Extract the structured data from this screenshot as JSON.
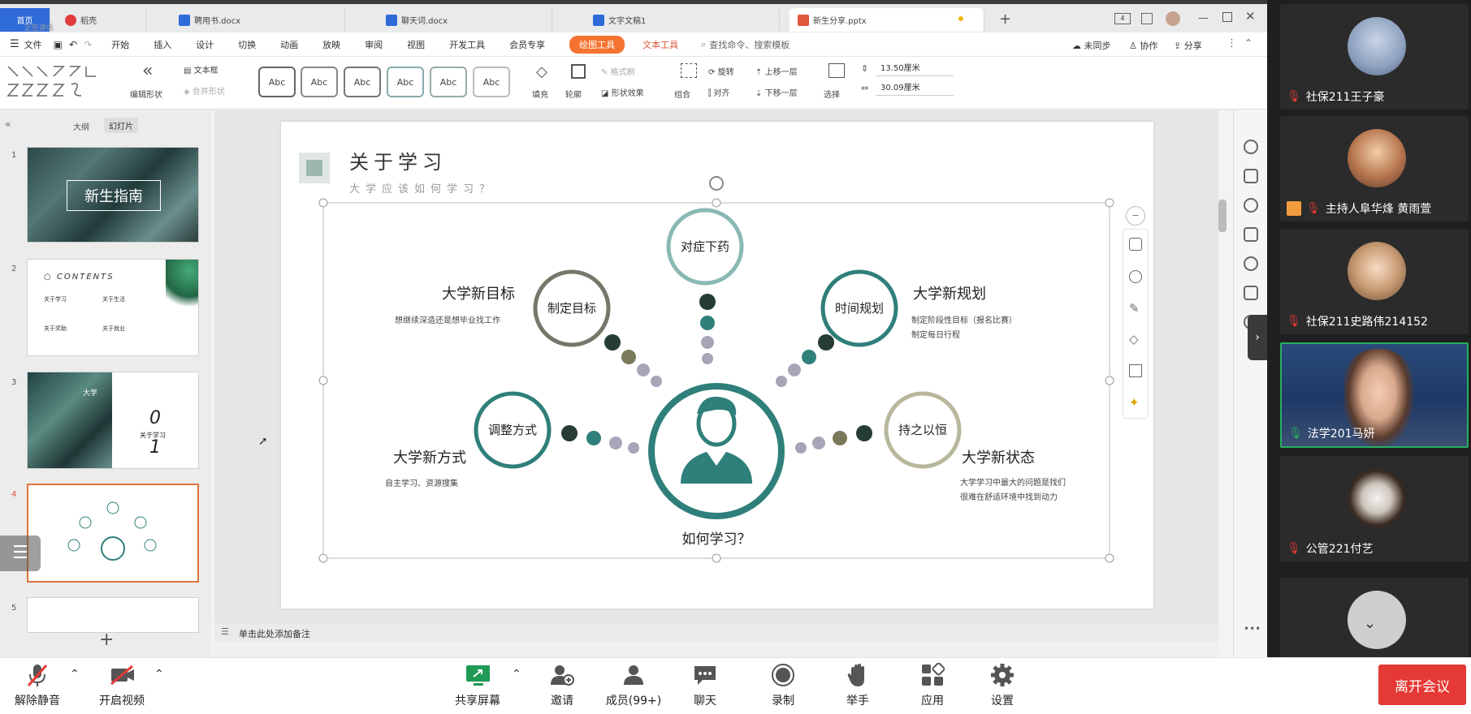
{
  "tabs": [
    {
      "label": "首页",
      "color": "#2f6bd8"
    },
    {
      "label": "稻壳",
      "color": "#e03b3b"
    },
    {
      "label": "聘用书.docx",
      "color": "#2f6bd8"
    },
    {
      "label": "聊天词.docx",
      "color": "#2f6bd8"
    },
    {
      "label": "文字文稿1",
      "color": "#2f6bd8"
    },
    {
      "label": "新生分享.pptx",
      "color": "#e0573b"
    }
  ],
  "meeting_status": "正在讲话",
  "menu": {
    "file": "文件",
    "items": [
      "开始",
      "插入",
      "设计",
      "切换",
      "动画",
      "放映",
      "审阅",
      "视图",
      "开发工具",
      "会员专享"
    ],
    "drawing_tools": "绘图工具",
    "text_tools": "文本工具",
    "search": "查找命令、搜索模板",
    "unsynced": "未同步",
    "collab": "协作",
    "share": "分享"
  },
  "toolbar": {
    "edit_shape": "编辑形状",
    "text_box": "文本框",
    "merge_shape": "合并形状",
    "abc": [
      "Abc",
      "Abc",
      "Abc",
      "Abc",
      "Abc",
      "Abc"
    ],
    "fill": "填充",
    "outline": "轮廓",
    "format_painter": "格式刷",
    "shape_effect": "形状效果",
    "group": "组合",
    "rotate": "旋转",
    "align": "对齐",
    "bring_forward": "上移一层",
    "send_backward": "下移一层",
    "select": "选择",
    "height": "13.50厘米",
    "width": "30.09厘米"
  },
  "leftpane": {
    "outline_tab": "大纲",
    "slides_tab": "幻灯片",
    "slides": [
      {
        "num": "1",
        "title": "新生指南"
      },
      {
        "num": "2",
        "title": "CONTENTS",
        "items": [
          "关于学习",
          "关于生活",
          "关于奖助",
          "关于就业"
        ]
      },
      {
        "num": "3",
        "title": "关于学习",
        "chapter": "0",
        "chapter2": "1",
        "extra": "大学"
      },
      {
        "num": "4"
      },
      {
        "num": "5"
      }
    ],
    "add": "+"
  },
  "slide": {
    "title": "关于学习",
    "subtitle": "大学应该如何学习？",
    "center_label": "如何学习？",
    "nodes": [
      {
        "label": "对症下药"
      },
      {
        "label": "制定目标",
        "head": "大学新目标",
        "desc1": "想继续深造还是想毕业找工作"
      },
      {
        "label": "时间规划",
        "head": "大学新规划",
        "desc1": "制定阶段性目标（报名比赛）",
        "desc2": "制定每日行程"
      },
      {
        "label": "调整方式",
        "head": "大学新方式",
        "desc1": "自主学习、资源搜集"
      },
      {
        "label": "持之以恒",
        "head": "大学新状态",
        "desc1": "大学学习中最大的问题是找们",
        "desc2": "很难在舒适环境中找到动力"
      }
    ]
  },
  "notes": "单击此处添加备注",
  "participants": [
    {
      "name": "社保211王子豪",
      "host": false
    },
    {
      "name": "主持人阜华烽 黄雨萱",
      "host": true
    },
    {
      "name": "社保211史路伟214152",
      "host": false
    },
    {
      "name": "法学201马妍",
      "host": false
    },
    {
      "name": "公管221付艺",
      "host": false
    }
  ],
  "meeting": {
    "unmute": "解除静音",
    "video": "开启视频",
    "share": "共享屏幕",
    "invite": "邀请",
    "members": "成员(99+)",
    "chat": "聊天",
    "record": "录制",
    "raise": "举手",
    "apps": "应用",
    "settings": "设置",
    "leave": "离开会议"
  },
  "colors": {
    "teal": "#2f7f7a",
    "dark": "#253d33",
    "olive": "#7a7a5a",
    "gray": "#a7a6b8",
    "leave": "#e53935"
  }
}
